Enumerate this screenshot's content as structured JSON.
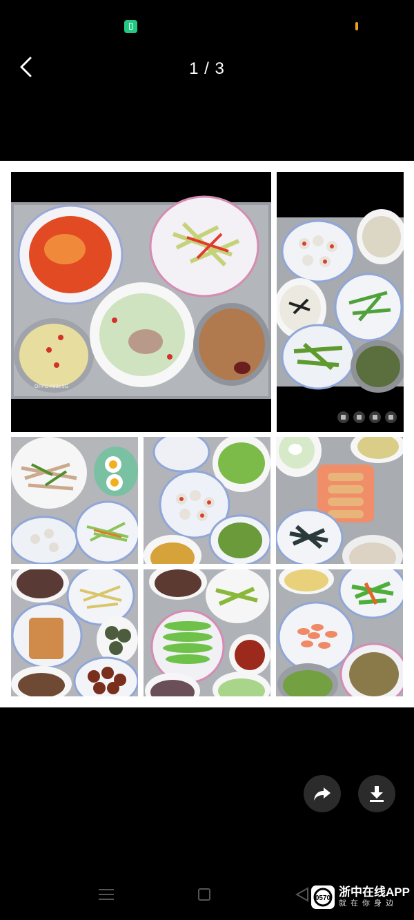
{
  "header": {
    "counter": "1 / 3"
  },
  "photo": {
    "camera_watermark": "OPPO A93s 5G",
    "photo_grid": [
      "main-tray",
      "side-tray",
      "tray-2",
      "tray-3",
      "tray-4",
      "tray-5",
      "tray-6",
      "tray-7"
    ]
  },
  "actions": {
    "share_icon": "share-arrow",
    "download_icon": "download-arrow"
  },
  "watermark": {
    "logo_text": "0570",
    "title": "浙中在线APP",
    "subtitle": "就在你身边"
  },
  "colors": {
    "background": "#000000",
    "frame": "#ffffff",
    "logo": "#ffffff"
  }
}
